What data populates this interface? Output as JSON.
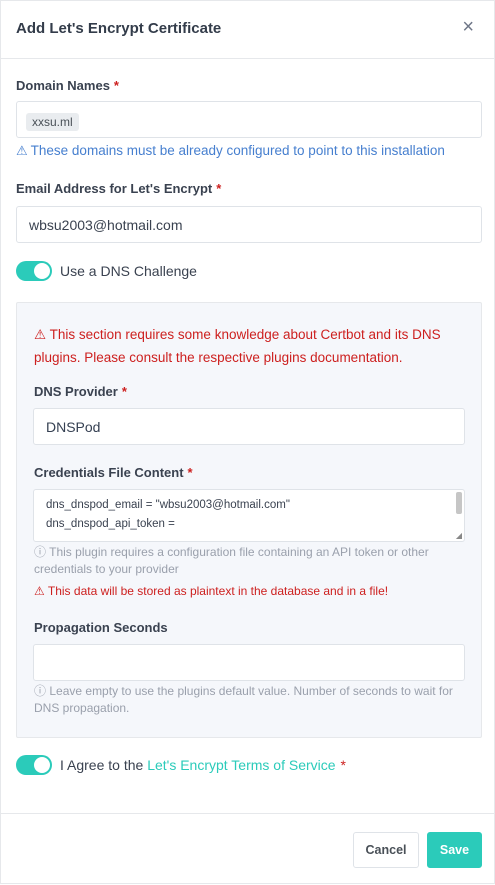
{
  "modal": {
    "title": "Add Let's Encrypt Certificate",
    "close_glyph": "×"
  },
  "domains": {
    "label": "Domain Names",
    "required_mark": "*",
    "tags": [
      "xxsu.ml"
    ],
    "hint_icon": "⚠",
    "hint": "These domains must be already configured to point to this installation"
  },
  "email": {
    "label": "Email Address for Let's Encrypt",
    "required_mark": "*",
    "value": "wbsu2003@hotmail.com"
  },
  "dns_toggle": {
    "label": "Use a DNS Challenge",
    "checked": true
  },
  "dns_section": {
    "warning_icon": "⚠",
    "warning": "This section requires some knowledge about Certbot and its DNS plugins. Please consult the respective plugins documentation.",
    "provider_label": "DNS Provider",
    "provider_required": "*",
    "provider_value": "DNSPod",
    "credentials_label": "Credentials File Content",
    "credentials_required": "*",
    "credentials_lines": [
      "dns_dnspod_email = \"wbsu2003@hotmail.com\"",
      "dns_dnspod_api_token ="
    ],
    "credentials_info_icon": "ⓘ",
    "credentials_info": "This plugin requires a configuration file containing an API token or other credentials to your provider",
    "credentials_warning_icon": "⚠",
    "credentials_warning": "This data will be stored as plaintext in the database and in a file!",
    "propagation_label": "Propagation Seconds",
    "propagation_value": "",
    "propagation_info_icon": "ⓘ",
    "propagation_info": "Leave empty to use the plugins default value. Number of seconds to wait for DNS propagation."
  },
  "agree": {
    "prefix": "I Agree to the",
    "link": "Let's Encrypt Terms of Service",
    "required_mark": "*",
    "checked": true
  },
  "buttons": {
    "cancel": "Cancel",
    "save": "Save"
  },
  "colors": {
    "accent": "#2bcbba",
    "danger": "#cd201f",
    "info": "#467fcf"
  }
}
